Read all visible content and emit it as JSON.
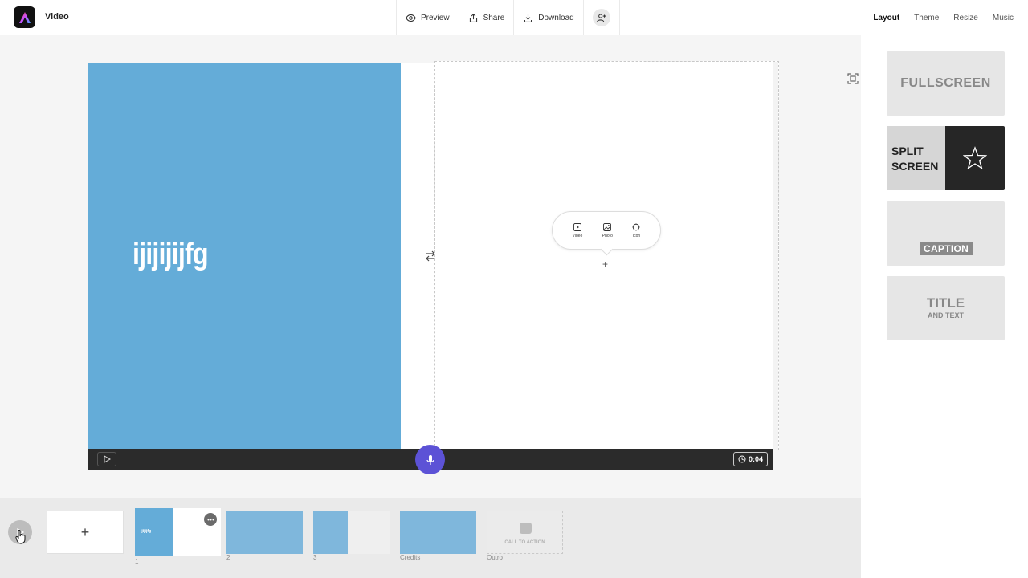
{
  "app": {
    "title": "Video"
  },
  "toolbar": {
    "preview": "Preview",
    "share": "Share",
    "download": "Download"
  },
  "tabs": [
    "Layout",
    "Theme",
    "Resize",
    "Music"
  ],
  "active_tab": "Layout",
  "canvas": {
    "slide_text": "ijijijijfg",
    "insert_options": [
      "Video",
      "Photo",
      "Icon"
    ],
    "plus": "+",
    "duration": "0:04"
  },
  "layouts": {
    "fullscreen": "FULLSCREEN",
    "split_line1": "SPLIT",
    "split_line2": "SCREEN",
    "caption": "CAPTION",
    "title_line1": "TITLE",
    "title_line2": "AND TEXT"
  },
  "timeline": {
    "add": "+",
    "scene1_thumb_text": "ijijijfg",
    "scene_labels": [
      "1",
      "2",
      "3",
      "Credits",
      "Outro"
    ],
    "cta": "CALL TO ACTION"
  },
  "colors": {
    "accent_purple": "#5c52d6",
    "slide_blue": "#64acd8",
    "control_bar": "#2b2b2b"
  }
}
